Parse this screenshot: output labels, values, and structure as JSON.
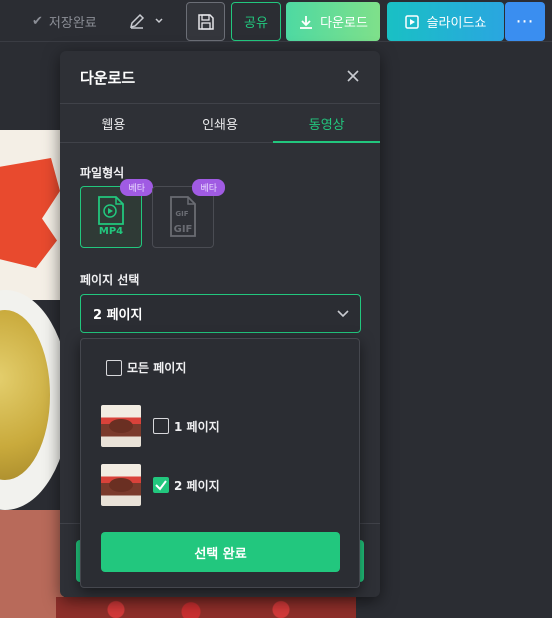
{
  "toolbar": {
    "saved_label": "저장완료",
    "share_label": "공유",
    "download_label": "다운로드",
    "slideshow_label": "슬라이드쇼",
    "more_label": "⋯"
  },
  "modal": {
    "title": "다운로드",
    "tabs": [
      {
        "label": "웹용",
        "active": false
      },
      {
        "label": "인쇄용",
        "active": false
      },
      {
        "label": "동영상",
        "active": true
      }
    ],
    "file_format_label": "파일형식",
    "formats": [
      {
        "name": "MP4",
        "badge": "베타",
        "selected": true
      },
      {
        "name": "GIF",
        "badge": "베타",
        "selected": false
      }
    ],
    "page_select_label": "페이지 선택",
    "selected_value": "2 페이지"
  },
  "dropdown": {
    "all_pages_label": "모든 페이지",
    "pages": [
      {
        "label": "1 페이지",
        "checked": false
      },
      {
        "label": "2 페이지",
        "checked": true
      }
    ],
    "confirm_label": "선택 완료"
  },
  "colors": {
    "accent": "#22c77e",
    "badge": "#a05be3",
    "panel": "#2e3036"
  }
}
